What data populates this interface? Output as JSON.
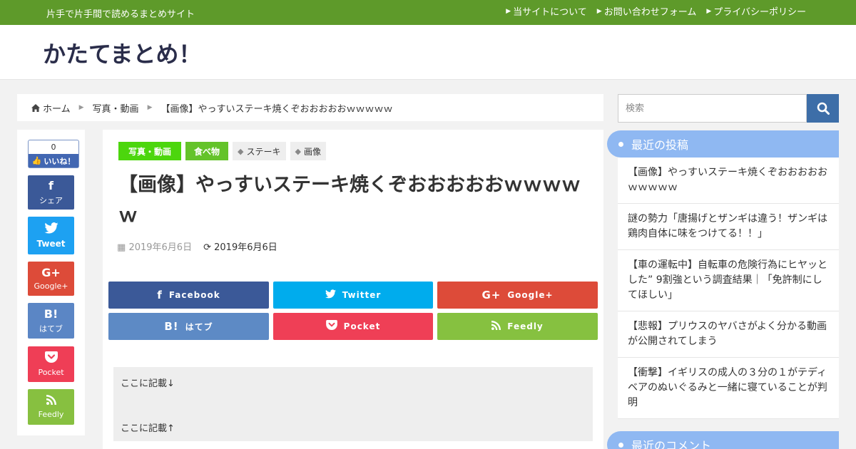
{
  "topbar": {
    "tagline": "片手で片手間で読めるまとめサイト",
    "nav": [
      "当サイトについて",
      "お問い合わせフォーム",
      "プライバシーポリシー"
    ]
  },
  "header": {
    "site_title": "かたてまとめ！"
  },
  "breadcrumb": {
    "home": "ホーム",
    "category": "写真・動画",
    "current": "【画像】やっすいステーキ焼くぞおおおおおｗｗｗｗｗ"
  },
  "share_sidebar": {
    "like_count": "0",
    "like_label": "いいね！",
    "facebook": "シェア",
    "twitter": "Tweet",
    "googleplus": "Google+",
    "hatena": "はてブ",
    "pocket": "Pocket",
    "feedly": "Feedly"
  },
  "article": {
    "categories": [
      "写真・動画",
      "食べ物"
    ],
    "tags": [
      "ステーキ",
      "画像"
    ],
    "title": "【画像】やっすいステーキ焼くぞおおおおおｗｗｗｗｗ",
    "published": "2019年6月6日",
    "updated": "2019年6月6日",
    "share_buttons": {
      "facebook": "Facebook",
      "twitter": "Twitter",
      "googleplus": "Google+",
      "hatena": "はてブ",
      "pocket": "Pocket",
      "feedly": "Feedly"
    },
    "content_line1": "ここに記載↓",
    "content_line2": "ここに記載↑"
  },
  "sidebar": {
    "search_placeholder": "検索",
    "recent_title": "最近の投稿",
    "recent_posts": [
      "【画像】やっすいステーキ焼くぞおおおおおｗｗｗｗｗ",
      "謎の勢力「唐揚げとザンギは違う！ザンギは鶏肉自体に味をつけてる！！」",
      "【車の運転中】自転車の危険行為にヒヤッとした” 9割強という調査結果｜「免許制にしてほしい」",
      "【悲報】プリウスのヤバさがよく分かる動画が公開されてしまう",
      "【衝撃】イギリスの成人の３分の１がテディベアのぬいぐるみと一緒に寝ていることが判明"
    ],
    "comments_title": "最近のコメント"
  },
  "colors": {
    "topbar": "#5e9a2a",
    "category": "#4cd60d",
    "widget_head": "#8fb8f2",
    "facebook": "#3b5998",
    "twitter": "#00aced",
    "googleplus": "#dd4b39",
    "pocket": "#ef3f56",
    "feedly": "#86c140"
  }
}
